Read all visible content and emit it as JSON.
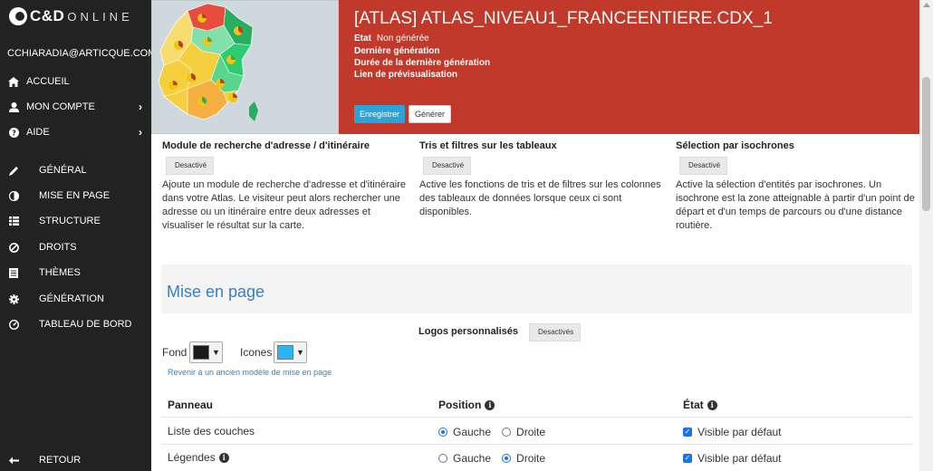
{
  "app": {
    "logo_text": "C&D",
    "logo_sub": "ONLINE",
    "user_email": "CCHIARADIA@ARTICQUE.COM"
  },
  "sidebar": {
    "items": [
      {
        "label": "ACCUEIL",
        "icon": "home-icon"
      },
      {
        "label": "MON COMPTE",
        "icon": "user-icon"
      },
      {
        "label": "AIDE",
        "icon": "question-icon"
      },
      {
        "label": "GÉNÉRAL",
        "icon": "pencil-icon"
      },
      {
        "label": "MISE EN PAGE",
        "icon": "contrast-icon"
      },
      {
        "label": "STRUCTURE",
        "icon": "grid-icon"
      },
      {
        "label": "DROITS",
        "icon": "ban-icon"
      },
      {
        "label": "THÈMES",
        "icon": "list-icon"
      },
      {
        "label": "GÉNÉRATION",
        "icon": "gear-icon"
      },
      {
        "label": "TABLEAU DE BORD",
        "icon": "dashboard-icon"
      }
    ],
    "back_label": "RETOUR"
  },
  "header": {
    "title": "[ATLAS] ATLAS_NIVEAU1_FRANCEENTIERE.CDX_1",
    "etat_label": "Etat",
    "etat_value": "Non générée",
    "last_gen_label": "Dernière génération",
    "duration_label": "Durée de la dernière génération",
    "preview_label": "Lien de prévisualisation",
    "save_button": "Enregistrer",
    "generate_button": "Générer"
  },
  "modules": [
    {
      "title": "Module de recherche d'adresse / d'itinéraire",
      "status": "Desactivé",
      "description": "Ajoute un module de recherche d'adresse et d'itinéraire dans votre Atlas. Le visiteur peut alors rechercher une adresse ou un itinéraire entre deux adresses et visualiser le résultat sur la carte."
    },
    {
      "title": "Tris et filtres sur les tableaux",
      "status": "Desactivé",
      "description": "Active les fonctions de tris et de filtres sur les colonnes des tableaux de données lorsque ceux ci sont disponibles."
    },
    {
      "title": "Sélection par isochrones",
      "status": "Desactivé",
      "description": "Active la sélection d'entités par isochrones. Un isochrone est la zone atteignable à partir d'un point de départ et d'un temps de parcours ou d'une distance routière."
    }
  ],
  "layout_section": {
    "title": "Mise en page",
    "logos_label": "Logos personnalisés",
    "logos_status": "Desactivés",
    "fond_label": "Fond",
    "fond_color": "#1a1a1a",
    "icones_label": "Icones",
    "icones_color": "#29b6f6",
    "revert_link": "Revenir à un ancien modèle de mise en page"
  },
  "table": {
    "headers": [
      "Panneau",
      "Position",
      "État"
    ],
    "rows": [
      {
        "panel": "Liste des couches",
        "pos_left": "Gauche",
        "pos_right": "Droite",
        "selected": "left",
        "visible_label": "Visible par défaut",
        "visible": true,
        "info": false
      },
      {
        "panel": "Légendes",
        "pos_left": "Gauche",
        "pos_right": "Droite",
        "selected": "right",
        "visible_label": "Visible par défaut",
        "visible": true,
        "info": true
      }
    ]
  },
  "colors": {
    "header_bg": "#c0392b",
    "sidebar_bg": "#222222",
    "accent": "#3a7fc1",
    "button_blue": "#2aa3d8"
  }
}
